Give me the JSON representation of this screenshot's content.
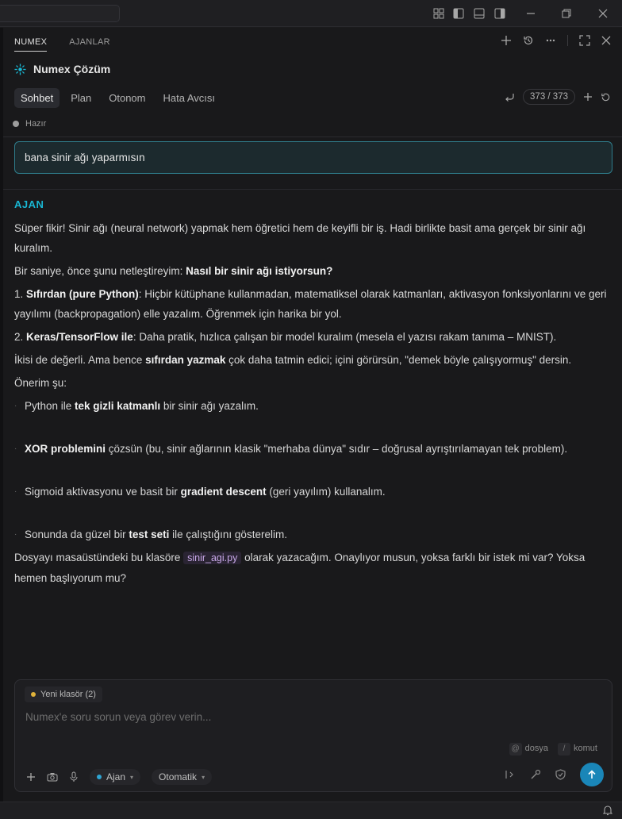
{
  "window": {
    "controls": [
      "layout-icon",
      "sidebar-left-icon",
      "panel-bottom-icon",
      "sidebar-right-icon",
      "minimize-icon",
      "restore-icon",
      "close-icon"
    ]
  },
  "header": {
    "tabs": [
      {
        "label": "NUMEX",
        "active": true
      },
      {
        "label": "AJANLAR",
        "active": false
      }
    ]
  },
  "app": {
    "title": "Numex Çözüm",
    "modes": [
      {
        "label": "Sohbet",
        "active": true
      },
      {
        "label": "Plan",
        "active": false
      },
      {
        "label": "Otonom",
        "active": false
      },
      {
        "label": "Hata Avcısı",
        "active": false
      }
    ],
    "counter": "373 / 373",
    "status": "Hazır"
  },
  "conversation": {
    "user_message": "bana sinir ağı yaparmısın",
    "agent_label": "AJAN",
    "p1": "Süper fikir! Sinir ağı (neural network) yapmak hem öğretici hem de keyifli bir iş. Hadi birlikte basit ama gerçek bir sinir ağı kuralım.",
    "p2_prefix": "Bir saniye, önce şunu netleştireyim: ",
    "p2_bold": "Nasıl bir sinir ağı istiyorsun?",
    "opt1_num": "1. ",
    "opt1_bold": "Sıfırdan (pure Python)",
    "opt1_rest": ": Hiçbir kütüphane kullanmadan, matematiksel olarak katmanları, aktivasyon fonksiyonlarını ve geri yayılımı (backpropagation) elle yazalım. Öğrenmek için harika bir yol.",
    "opt2_num": "2. ",
    "opt2_bold": "Keras/TensorFlow ile",
    "opt2_rest": ": Daha pratik, hızlıca çalışan bir model kuralım (mesela el yazısı rakam tanıma – MNIST).",
    "p3_prefix": "İkisi de değerli. Ama bence ",
    "p3_bold": "sıfırdan yazmak",
    "p3_rest": " çok daha tatmin edici; içini görürsün, \"demek böyle çalışıyormuş\" dersin.",
    "p4": "Önerim şu:",
    "b1_pre": "Python ile ",
    "b1_bold": "tek gizli katmanlı",
    "b1_post": " bir sinir ağı yazalım.",
    "b2_bold": "XOR problemini",
    "b2_post": " çözsün (bu, sinir ağlarının klasik \"merhaba dünya\" sıdır – doğrusal ayrıştırılamayan tek problem).",
    "b3_pre": "Sigmoid aktivasyonu ve basit bir ",
    "b3_bold": "gradient descent",
    "b3_post": " (geri yayılım) kullanalım.",
    "b4_pre": "Sonunda da güzel bir ",
    "b4_bold": "test seti",
    "b4_post": " ile çalıştığını gösterelim.",
    "p5_pre": "Dosyayı masaüstündeki bu klasöre ",
    "p5_code": "sinir_agi.py",
    "p5_post": " olarak yazacağım. Onaylıyor musun, yoksa farklı bir istek mi var? Yoksa hemen başlıyorum mu?"
  },
  "composer": {
    "folder_chip": "Yeni klasör (2)",
    "placeholder": "Numex'e soru sorun veya görev verin...",
    "hint_file_key": "@",
    "hint_file": "dosya",
    "hint_cmd_key": "/",
    "hint_cmd": "komut",
    "agent_mode": "Ajan",
    "model_mode": "Otomatik"
  },
  "colors": {
    "accent": "#19b6d2",
    "send": "#1a86b8",
    "user_border": "#2f7d8c"
  }
}
